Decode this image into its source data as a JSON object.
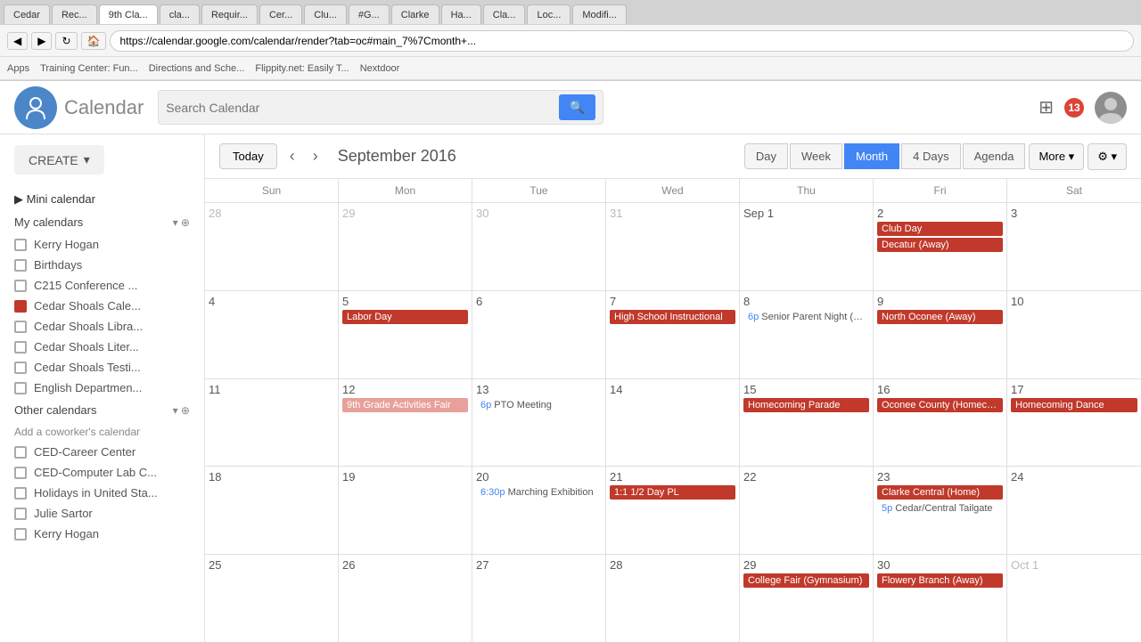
{
  "browser": {
    "tabs": [
      {
        "label": "Cedar",
        "active": false
      },
      {
        "label": "Rec...",
        "active": false
      },
      {
        "label": "9th Cla...",
        "active": true
      },
      {
        "label": "cla...",
        "active": false
      },
      {
        "label": "Requir...",
        "active": false
      },
      {
        "label": "Cer...",
        "active": false
      },
      {
        "label": "Clu...",
        "active": false
      },
      {
        "label": "#G...",
        "active": false
      },
      {
        "label": "Clarke",
        "active": false
      },
      {
        "label": "Ha...",
        "active": false
      },
      {
        "label": "Cla...",
        "active": false
      },
      {
        "label": "Loc...",
        "active": false
      },
      {
        "label": "Modifi...",
        "active": false
      }
    ],
    "url": "https://calendar.google.com/calendar/render?tab=oc#main_7%7Cmonth+...",
    "bookmarks": [
      "Apps",
      "Training Center: Fun...",
      "Directions and Sche...",
      "Flippity.net: Easily T...",
      "Nextdoor"
    ]
  },
  "header": {
    "app_title": "Calendar",
    "search_placeholder": "Search Calendar",
    "search_button": "🔍",
    "notifications": "13"
  },
  "sidebar": {
    "create_label": "CREATE",
    "mini_calendar_label": "Mini calendar",
    "my_calendars_label": "My calendars",
    "other_calendars_label": "Other calendars",
    "add_coworker_label": "Add a coworker's calendar",
    "my_calendar_items": [
      {
        "name": "Kerry Hogan",
        "checked": false,
        "color": "#aaa"
      },
      {
        "name": "Birthdays",
        "checked": false,
        "color": "#aaa"
      },
      {
        "name": "C215 Conference ...",
        "checked": false,
        "color": "#aaa"
      },
      {
        "name": "Cedar Shoals Cale...",
        "checked": true,
        "color": "#c0392b"
      },
      {
        "name": "Cedar Shoals Libra...",
        "checked": false,
        "color": "#aaa"
      },
      {
        "name": "Cedar Shoals Liter...",
        "checked": false,
        "color": "#aaa"
      },
      {
        "name": "Cedar Shoals Testi...",
        "checked": false,
        "color": "#aaa"
      },
      {
        "name": "English Departmen...",
        "checked": false,
        "color": "#aaa"
      }
    ],
    "other_calendar_items": [
      {
        "name": "CED-Career Center",
        "checked": false,
        "color": "#aaa"
      },
      {
        "name": "CED-Computer Lab C...",
        "checked": false,
        "color": "#aaa"
      },
      {
        "name": "Holidays in United Sta...",
        "checked": false,
        "color": "#aaa"
      },
      {
        "name": "Julie Sartor",
        "checked": false,
        "color": "#aaa"
      },
      {
        "name": "Kerry Hogan",
        "checked": false,
        "color": "#aaa"
      }
    ]
  },
  "calendar": {
    "toolbar": {
      "today_label": "Today",
      "month_title": "September 2016",
      "view_day": "Day",
      "view_week": "Week",
      "view_month": "Month",
      "view_4days": "4 Days",
      "view_agenda": "Agenda",
      "view_more": "More ▾"
    },
    "day_headers": [
      "Sun",
      "Mon",
      "Tue",
      "Wed",
      "Thu",
      "Fri",
      "Sat"
    ],
    "weeks": [
      {
        "days": [
          {
            "num": "28",
            "other": true,
            "events": []
          },
          {
            "num": "29",
            "other": true,
            "events": []
          },
          {
            "num": "30",
            "other": true,
            "events": []
          },
          {
            "num": "31",
            "other": true,
            "events": []
          },
          {
            "num": "Sep 1",
            "other": false,
            "events": []
          },
          {
            "num": "2",
            "other": false,
            "events": [
              {
                "type": "red-solid",
                "text": "Club Day"
              },
              {
                "type": "red-solid",
                "text": "Decatur (Away)"
              }
            ]
          },
          {
            "num": "3",
            "other": false,
            "events": []
          }
        ]
      },
      {
        "days": [
          {
            "num": "4",
            "other": false,
            "events": []
          },
          {
            "num": "5",
            "other": false,
            "events": [
              {
                "type": "red-solid",
                "text": "Labor Day"
              }
            ]
          },
          {
            "num": "6",
            "other": false,
            "events": []
          },
          {
            "num": "7",
            "other": false,
            "events": [
              {
                "type": "red-solid",
                "text": "High School Instructional"
              }
            ]
          },
          {
            "num": "8",
            "other": false,
            "events": [
              {
                "type": "timed",
                "time": "6p",
                "text": "Senior Parent Night (The..."
              }
            ]
          },
          {
            "num": "9",
            "other": false,
            "events": [
              {
                "type": "red-solid",
                "text": "North Oconee (Away)"
              }
            ]
          },
          {
            "num": "10",
            "other": false,
            "events": []
          }
        ]
      },
      {
        "days": [
          {
            "num": "11",
            "other": false,
            "events": []
          },
          {
            "num": "12",
            "other": false,
            "events": [
              {
                "type": "red-bg",
                "text": "9th Grade Activities Fair"
              }
            ]
          },
          {
            "num": "13",
            "other": false,
            "events": [
              {
                "type": "timed",
                "time": "6p",
                "text": "PTO Meeting"
              }
            ]
          },
          {
            "num": "14",
            "other": false,
            "events": []
          },
          {
            "num": "15",
            "other": false,
            "events": [
              {
                "type": "red-solid",
                "text": "Homecoming Parade"
              }
            ]
          },
          {
            "num": "16",
            "other": false,
            "events": [
              {
                "type": "red-solid",
                "text": "Oconee County (Homecon..."
              }
            ]
          },
          {
            "num": "17",
            "other": false,
            "events": [
              {
                "type": "red-solid",
                "text": "Homecoming Dance"
              }
            ]
          }
        ]
      },
      {
        "days": [
          {
            "num": "18",
            "other": false,
            "events": []
          },
          {
            "num": "19",
            "other": false,
            "events": []
          },
          {
            "num": "20",
            "other": false,
            "events": [
              {
                "type": "timed",
                "time": "6:30p",
                "text": "Marching Exhibition"
              }
            ]
          },
          {
            "num": "21",
            "other": false,
            "events": [
              {
                "type": "red-solid",
                "text": "1:1 1/2 Day PL"
              }
            ]
          },
          {
            "num": "22",
            "other": false,
            "events": []
          },
          {
            "num": "23",
            "other": false,
            "events": [
              {
                "type": "red-solid",
                "text": "Clarke Central (Home)"
              },
              {
                "type": "timed",
                "time": "5p",
                "text": "Cedar/Central Tailgate"
              }
            ]
          },
          {
            "num": "24",
            "other": false,
            "events": []
          }
        ]
      },
      {
        "days": [
          {
            "num": "25",
            "other": false,
            "events": []
          },
          {
            "num": "26",
            "other": false,
            "events": []
          },
          {
            "num": "27",
            "other": false,
            "events": []
          },
          {
            "num": "28",
            "other": false,
            "events": []
          },
          {
            "num": "29",
            "other": false,
            "events": [
              {
                "type": "red-solid",
                "text": "College Fair (Gymnasium)"
              }
            ]
          },
          {
            "num": "30",
            "other": false,
            "events": [
              {
                "type": "red-solid",
                "text": "Flowery Branch (Away)"
              }
            ]
          },
          {
            "num": "Oct 1",
            "other": true,
            "events": []
          }
        ]
      }
    ]
  }
}
